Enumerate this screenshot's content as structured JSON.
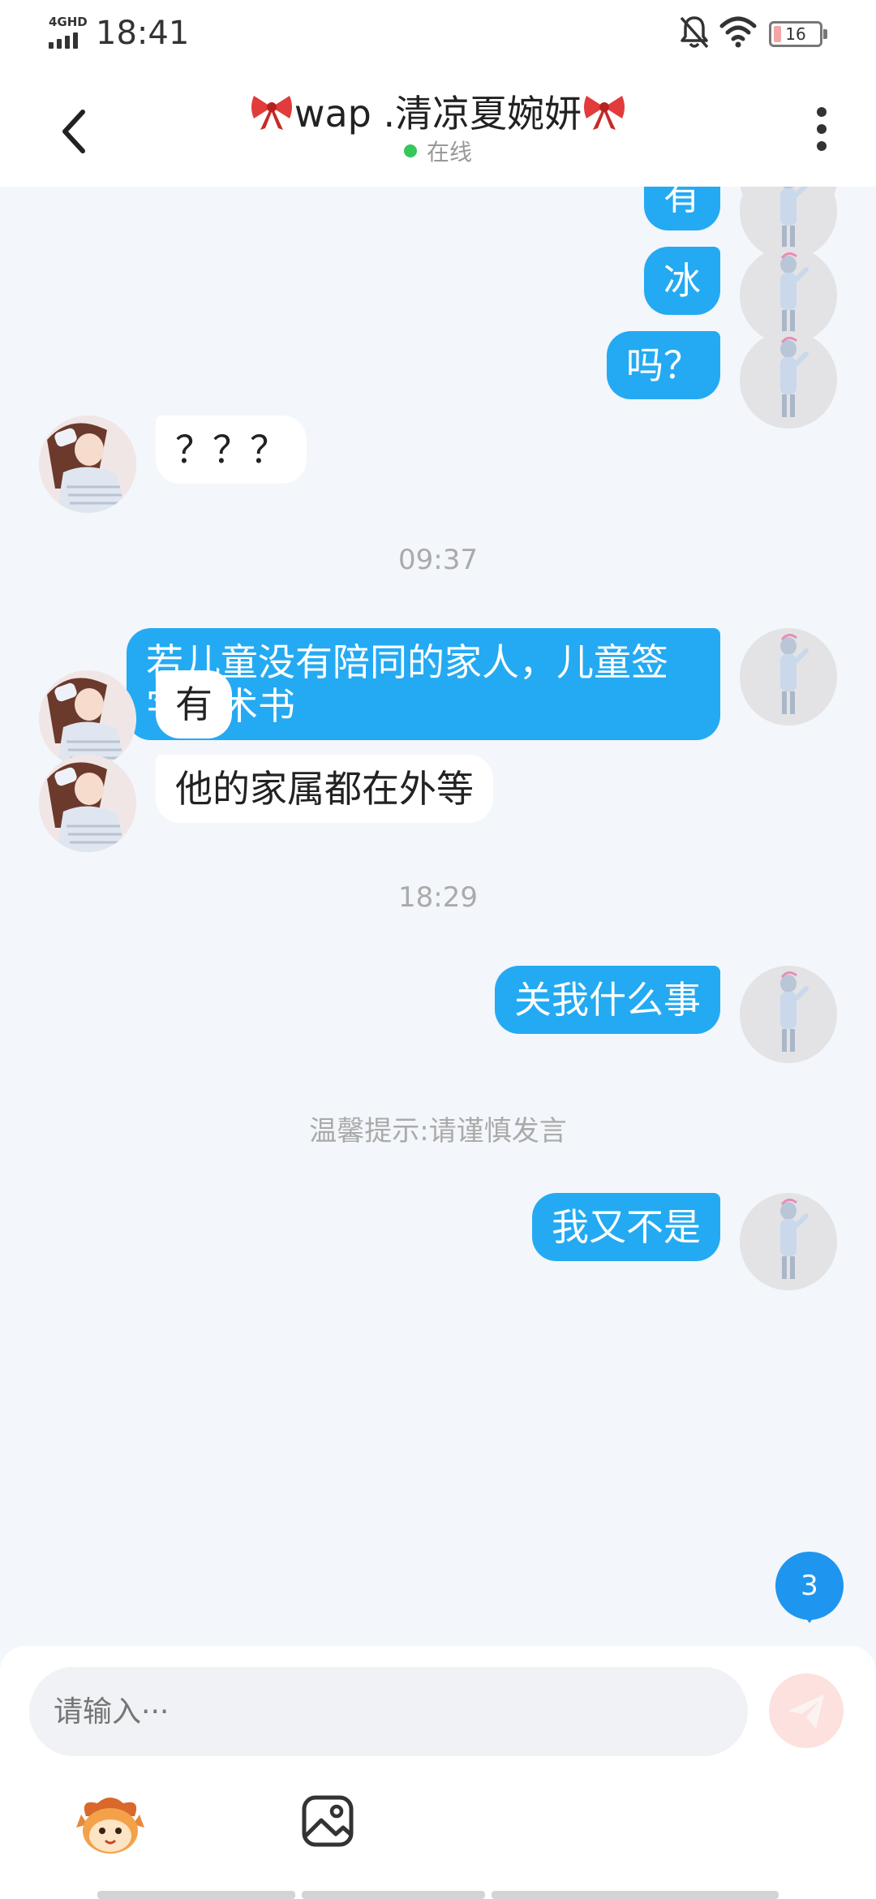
{
  "status_bar": {
    "network": "4GHD",
    "time": "18:41",
    "battery": "16",
    "battery_level": 0.16
  },
  "header": {
    "title": "wap .清凉夏婉妍",
    "presence": "在线"
  },
  "messages": [
    {
      "from": "me",
      "text": "有"
    },
    {
      "from": "me",
      "text": "冰"
    },
    {
      "from": "me",
      "text": "吗？"
    },
    {
      "from": "them",
      "text": "？？？"
    },
    {
      "type": "time",
      "text": "09:37"
    },
    {
      "from": "me",
      "text": " 若儿童没有陪同的家人，儿童签字手术书"
    },
    {
      "from": "them",
      "text": "有"
    },
    {
      "from": "them",
      "text": "他的家属都在外等"
    },
    {
      "type": "time",
      "text": "18:29"
    },
    {
      "from": "me",
      "text": "关我什么事"
    },
    {
      "type": "tip",
      "text": "温馨提示:请谨慎发言"
    },
    {
      "from": "me",
      "text": "我又不是"
    }
  ],
  "unread_badge": "3",
  "input": {
    "placeholder": "请输入···"
  },
  "icons": [
    "back-icon",
    "bow-icon",
    "more-icon",
    "mute-icon",
    "wifi-icon",
    "send-icon",
    "sticker-icon",
    "image-icon"
  ],
  "colors": {
    "bubble_me": "#24aaf2",
    "bubble_them": "#ffffff",
    "background": "#f3f6fa",
    "online": "#34c759",
    "badge": "#1e96f0"
  }
}
